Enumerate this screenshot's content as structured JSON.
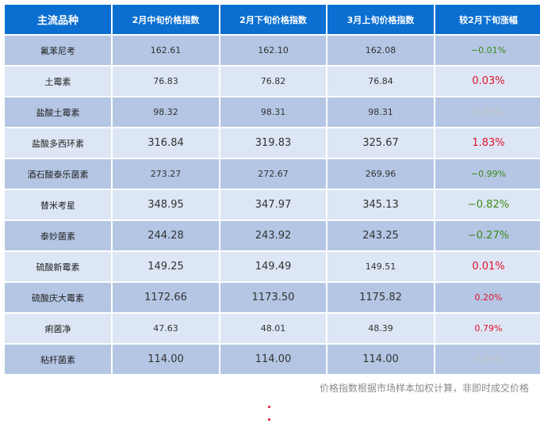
{
  "table": {
    "headers": [
      "主流品种",
      "2月中旬价格指数",
      "2月下旬价格指数",
      "3月上旬价格指数",
      "较2月下旬涨幅"
    ],
    "rows": [
      {
        "name": "氟苯尼考",
        "mid_feb": "162.61",
        "late_feb": "162.10",
        "early_mar": "162.08",
        "change": "−0.01%",
        "dir": "down"
      },
      {
        "name": "土霉素",
        "mid_feb": "76.83",
        "late_feb": "76.82",
        "early_mar": "76.84",
        "change": "0.03%",
        "dir": "up"
      },
      {
        "name": "盐酸土霉素",
        "mid_feb": "98.32",
        "late_feb": "98.31",
        "early_mar": "98.31",
        "change": "0.00%",
        "dir": "flat"
      },
      {
        "name": "盐酸多西环素",
        "mid_feb": "316.84",
        "late_feb": "319.83",
        "early_mar": "325.67",
        "change": "1.83%",
        "dir": "up"
      },
      {
        "name": "酒石酸泰乐菌素",
        "mid_feb": "273.27",
        "late_feb": "272.67",
        "early_mar": "269.96",
        "change": "−0.99%",
        "dir": "down"
      },
      {
        "name": "替米考星",
        "mid_feb": "348.95",
        "late_feb": "347.97",
        "early_mar": "345.13",
        "change": "−0.82%",
        "dir": "down"
      },
      {
        "name": "泰妙菌素",
        "mid_feb": "244.28",
        "late_feb": "243.92",
        "early_mar": "243.25",
        "change": "−0.27%",
        "dir": "down"
      },
      {
        "name": "硫酸新霉素",
        "mid_feb": "149.25",
        "late_feb": "149.49",
        "early_mar": "149.51",
        "change": "0.01%",
        "dir": "up"
      },
      {
        "name": "硫酸庆大霉素",
        "mid_feb": "1172.66",
        "late_feb": "1173.50",
        "early_mar": "1175.82",
        "change": "0.20%",
        "dir": "up"
      },
      {
        "name": "痢菌净",
        "mid_feb": "47.63",
        "late_feb": "48.01",
        "early_mar": "48.39",
        "change": "0.79%",
        "dir": "up"
      },
      {
        "name": "粘杆菌素",
        "mid_feb": "114.00",
        "late_feb": "114.00",
        "early_mar": "114.00",
        "change": "0.00%",
        "dir": "flat"
      }
    ]
  },
  "footnote": "价格指数根据市场样本加权计算，非即时成交价格",
  "colors": {
    "header_bg": "#0b6fd1",
    "row_dark": "#b4c6e4",
    "row_light": "#dce6f4",
    "down": "#3d8a1a",
    "up": "#e0142c",
    "flat": "#c8c8c8"
  }
}
